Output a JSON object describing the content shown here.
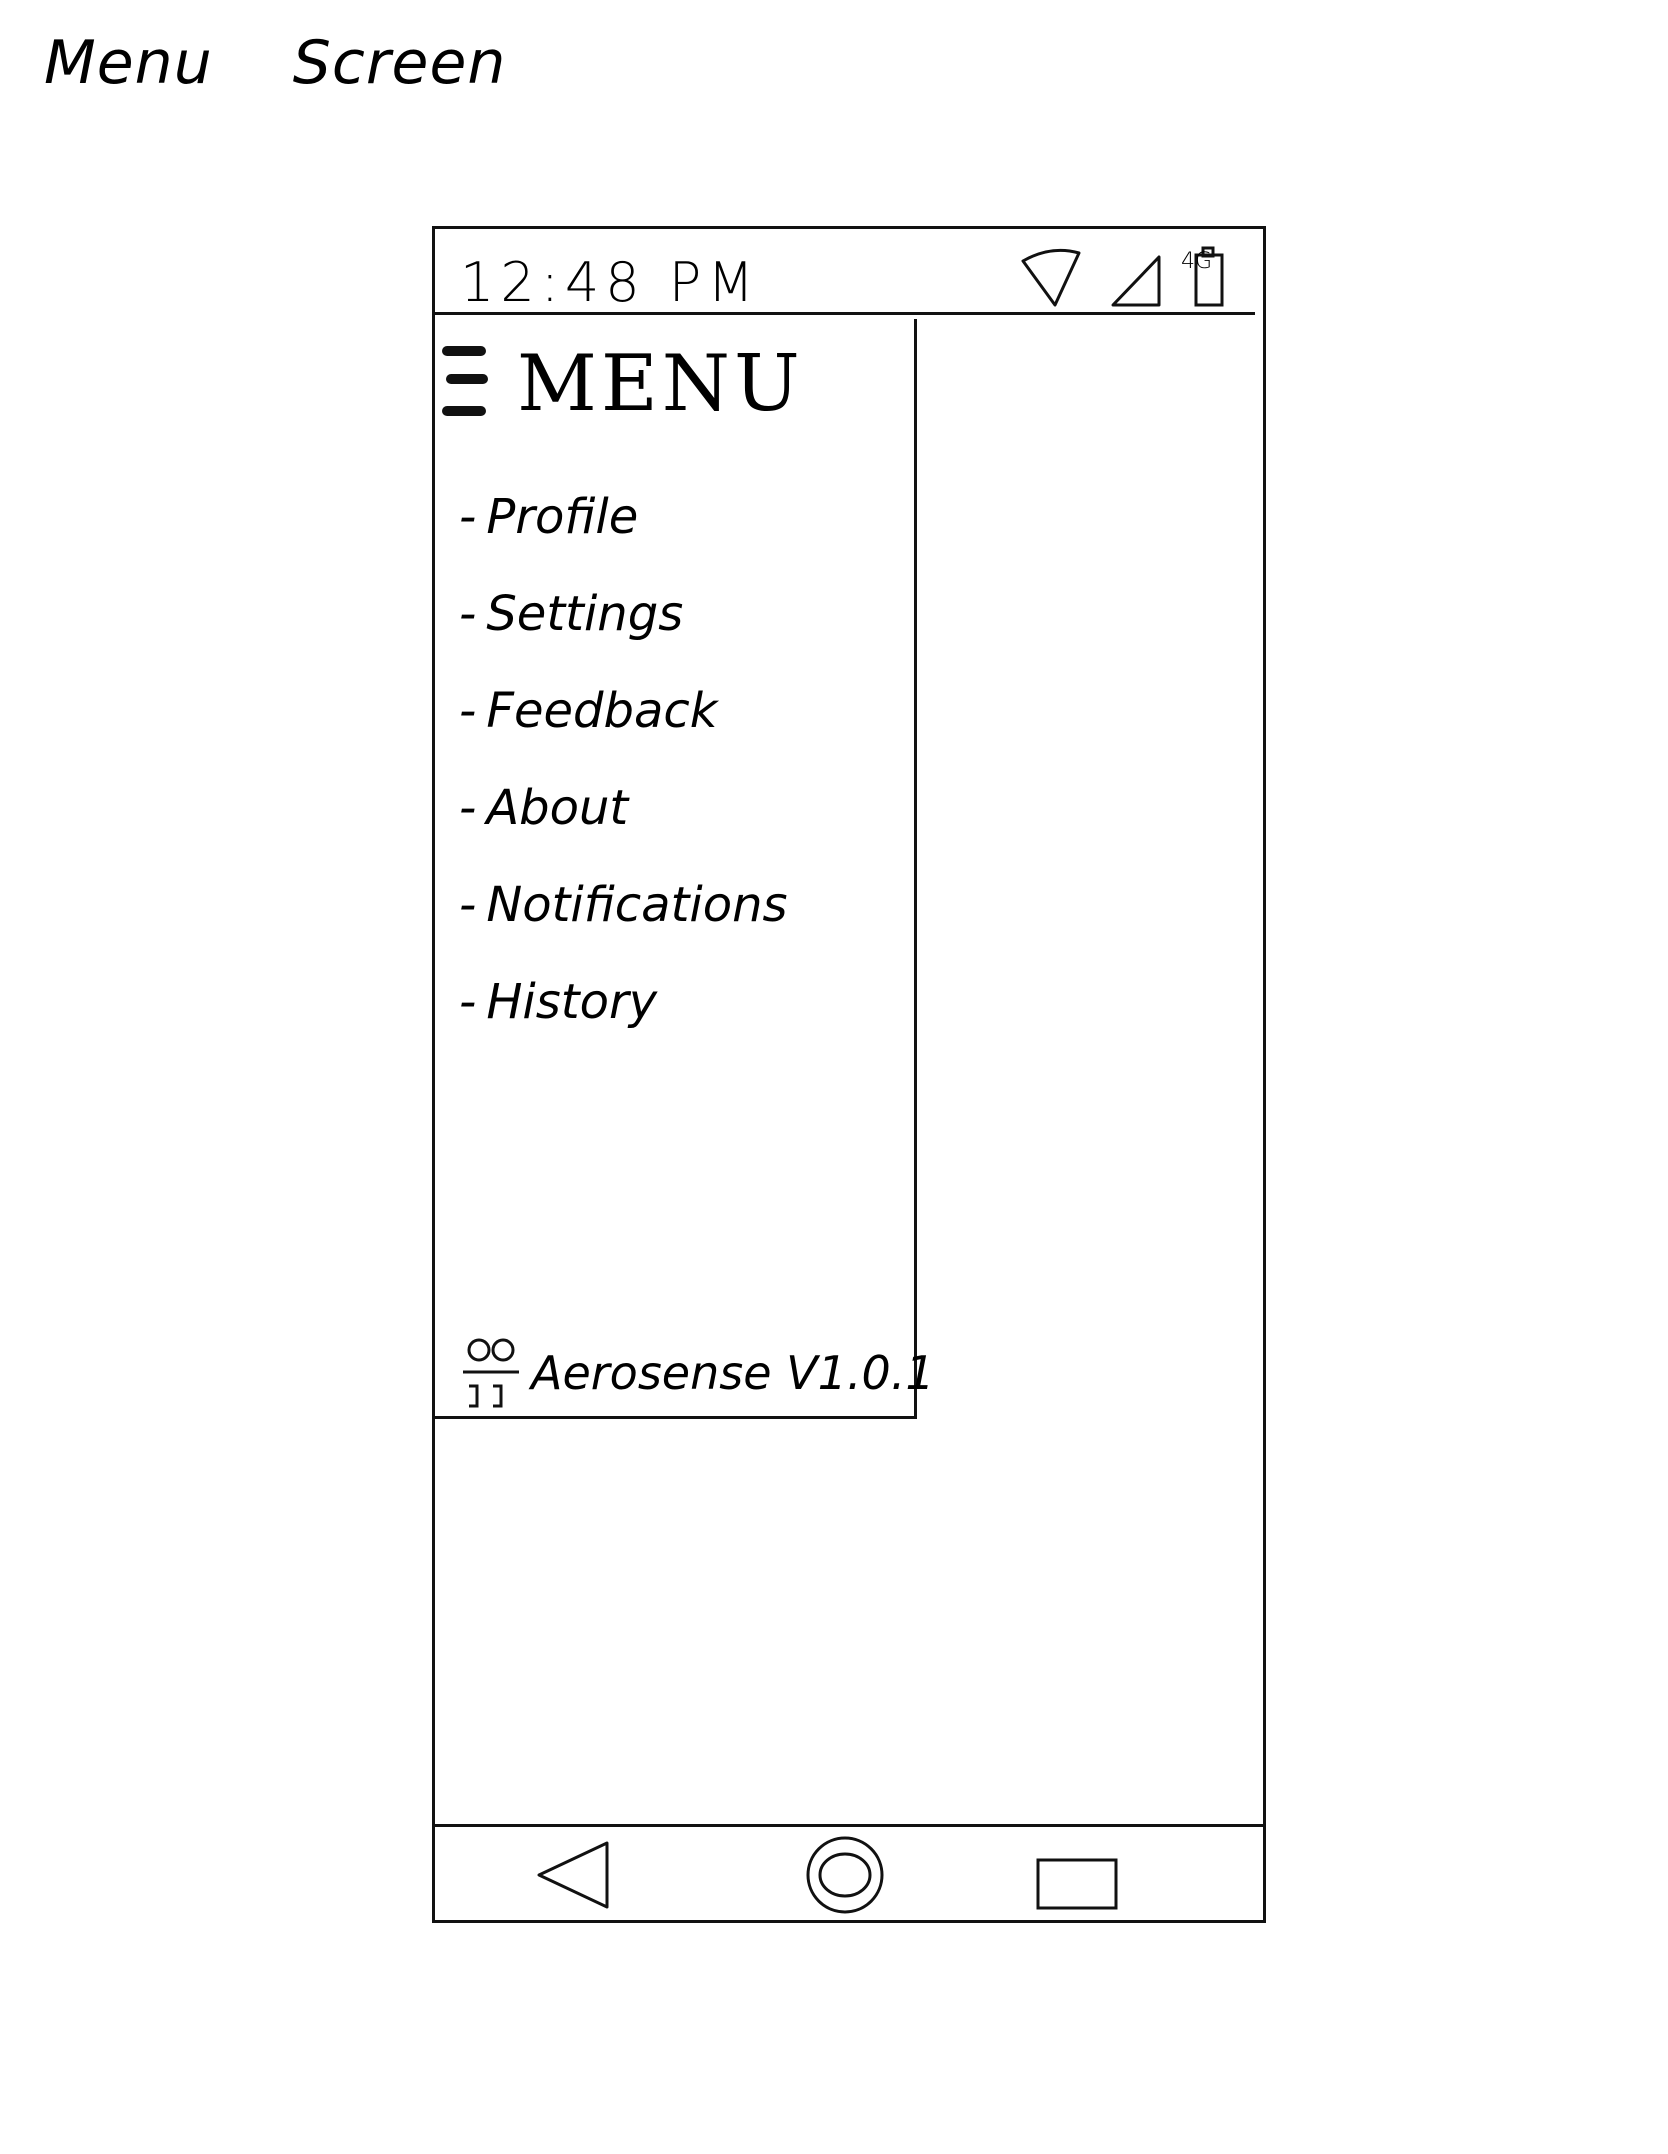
{
  "page": {
    "title": "Menu Screen"
  },
  "status_bar": {
    "time": "12:48 PM",
    "network": "4G",
    "icons": [
      "wifi-icon",
      "cellular-signal-icon",
      "battery-icon"
    ]
  },
  "drawer": {
    "hamburger_icon": "hamburger-menu-icon",
    "title": "MENU",
    "items": [
      {
        "label": "Profile"
      },
      {
        "label": "Settings"
      },
      {
        "label": "Feedback"
      },
      {
        "label": "About"
      },
      {
        "label": "Notifications"
      },
      {
        "label": "History"
      }
    ],
    "footer": {
      "logo_icon": "aerosense-logo-icon",
      "brand": "Aerosense V1.0.1"
    }
  },
  "nav_bar": {
    "buttons": [
      "back-icon",
      "home-icon",
      "recents-icon"
    ]
  }
}
